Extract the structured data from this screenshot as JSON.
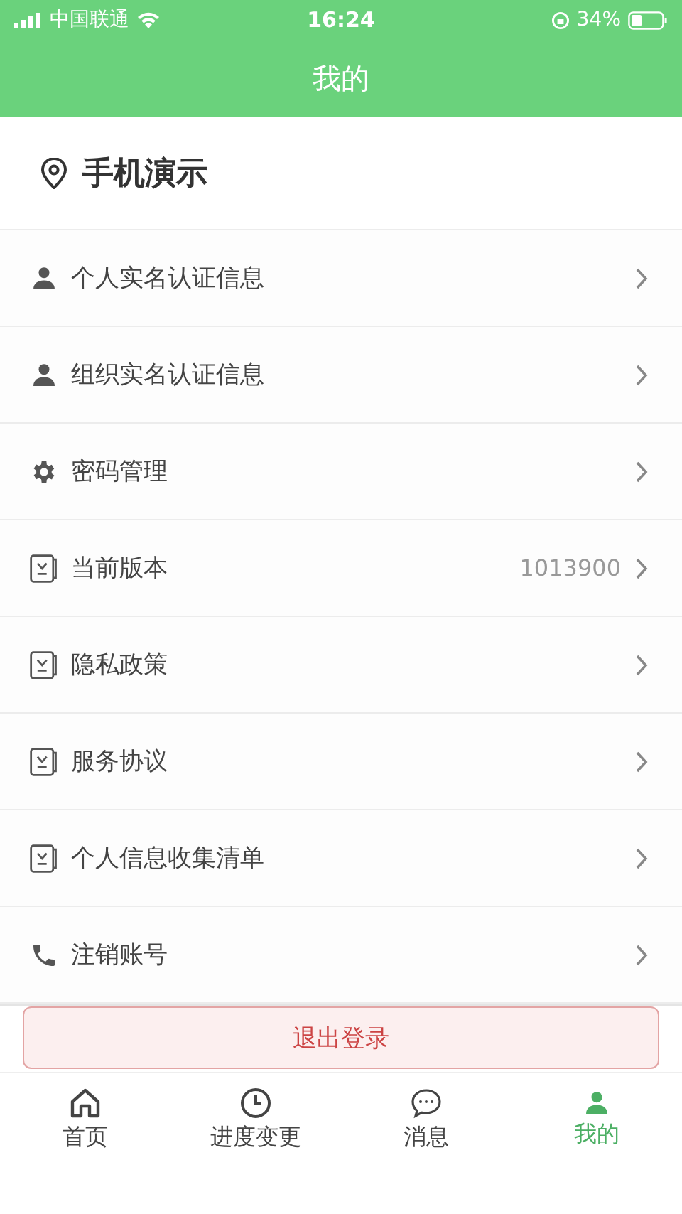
{
  "status_bar": {
    "carrier": "中国联通",
    "time": "16:24",
    "battery": "34%"
  },
  "nav": {
    "title": "我的"
  },
  "profile": {
    "name": "手机演示"
  },
  "menu": [
    {
      "kind": "person",
      "label": "个人实名认证信息"
    },
    {
      "kind": "person",
      "label": "组织实名认证信息"
    },
    {
      "kind": "settings",
      "label": "密码管理"
    },
    {
      "kind": "document",
      "label": "当前版本",
      "value": "1013900"
    },
    {
      "kind": "document",
      "label": "隐私政策"
    },
    {
      "kind": "document",
      "label": "服务协议"
    },
    {
      "kind": "document",
      "label": "个人信息收集清单"
    },
    {
      "kind": "phone",
      "label": "注销账号"
    }
  ],
  "logout_button": "退出登录",
  "tabs": [
    {
      "kind": "home",
      "label": "首页",
      "selected": false
    },
    {
      "kind": "clock",
      "label": "进度变更",
      "selected": false
    },
    {
      "kind": "chat",
      "label": "消息",
      "selected": false
    },
    {
      "kind": "person",
      "label": "我的",
      "selected": true
    }
  ]
}
